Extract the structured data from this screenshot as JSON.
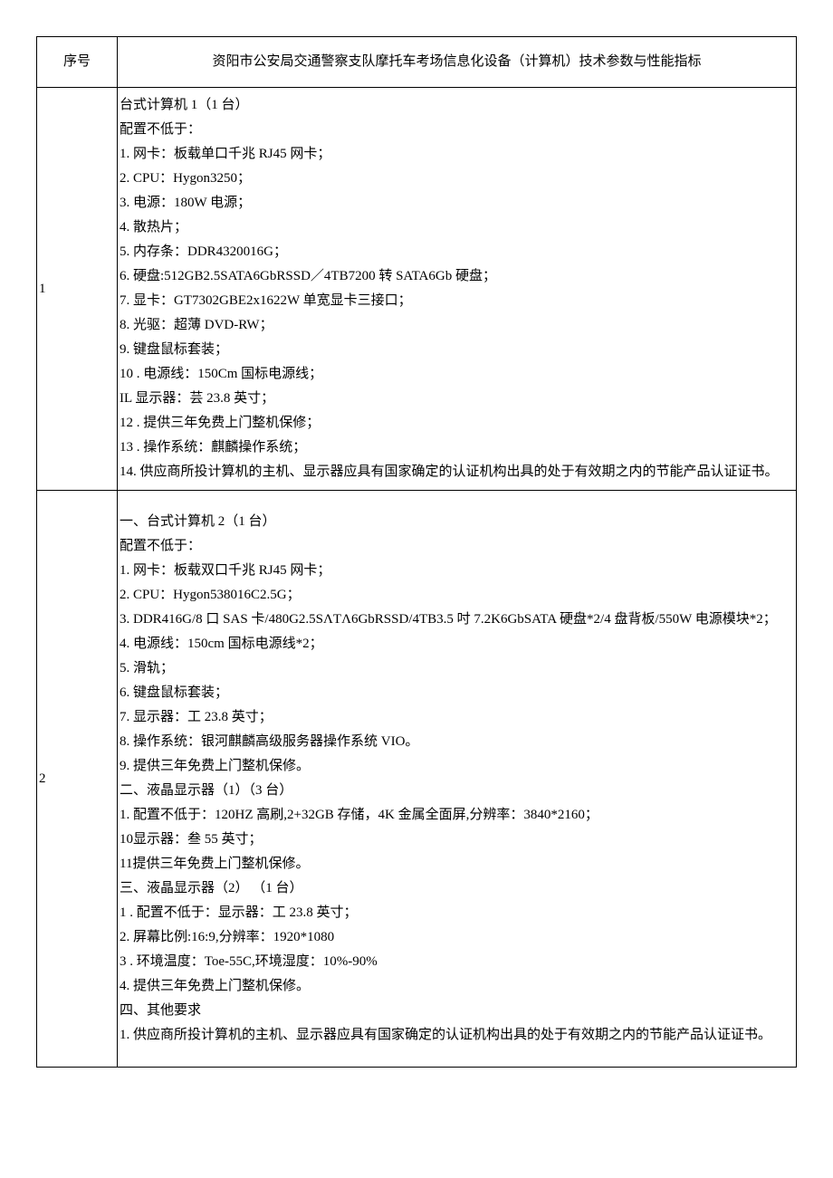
{
  "headers": {
    "serial": "序号",
    "title": "资阳市公安局交通警察支队摩托车考场信息化设备（计算机）技术参数与性能指标"
  },
  "rows": [
    {
      "serial": "1",
      "lines": [
        "台式计算机 1（1 台）",
        "配置不低于：",
        "1. 网卡：板载单口千兆 RJ45 网卡；",
        "2. CPU：Hygon3250；",
        "3. 电源：180W 电源；",
        "4. 散热片；",
        "5. 内存条：DDR4320016G；",
        "6. 硬盘:512GB2.5SATA6GbRSSD／4TB7200 转 SATA6Gb 硬盘；",
        "7. 显卡：GT7302GBE2x1622W 单宽显卡三接口；",
        "8. 光驱：超薄 DVD-RW；",
        "9. 键盘鼠标套装；",
        "10      . 电源线：150Cm 国标电源线；",
        "IL 显示器：芸 23.8 英寸；",
        "12      . 提供三年免费上门整机保修；",
        "13      . 操作系统：麒麟操作系统；",
        "14. 供应商所投计算机的主机、显示器应具有国家确定的认证机构出具的处于有效期之内的节能产品认证证书。"
      ]
    },
    {
      "serial": "2",
      "lines": [
        "",
        "一、台式计算机 2（1 台）",
        "配置不低于：",
        "1. 网卡：板载双口千兆 RJ45 网卡；",
        "2. CPU：Hygon538016C2.5G；",
        "3. DDR416G/8 口 SAS 卡/480G2.5SΛTΛ6GbRSSD/4TB3.5 吋 7.2K6GbSATA 硬盘*2/4 盘背板/550W 电源模块*2；",
        "4. 电源线：150cm 国标电源线*2；",
        "5. 滑轨；",
        "6. 键盘鼠标套装；",
        "7. 显示器：工 23.8 英寸；",
        "8. 操作系统：银河麒麟高级服务器操作系统 VIO。",
        "9. 提供三年免费上门整机保修。",
        "二、液晶显示器（1）（3 台）",
        "1. 配置不低于：120HZ 高刷,2+32GB 存储，4K 金属全面屏,分辨率：3840*2160；",
        "10显示器：叁 55 英寸；",
        "11提供三年免费上门整机保修。",
        "三、液晶显示器（2）   （1 台）",
        "1       . 配置不低于：显示器：工 23.8 英寸；",
        "2. 屏幕比例:16:9,分辨率：1920*1080",
        "3       . 环境温度：Toe-55C,环境湿度：10%-90%",
        "4. 提供三年免费上门整机保修。",
        "四、其他要求",
        "1. 供应商所投计算机的主机、显示器应具有国家确定的认证机构出具的处于有效期之内的节能产品认证证书。",
        ""
      ]
    }
  ]
}
